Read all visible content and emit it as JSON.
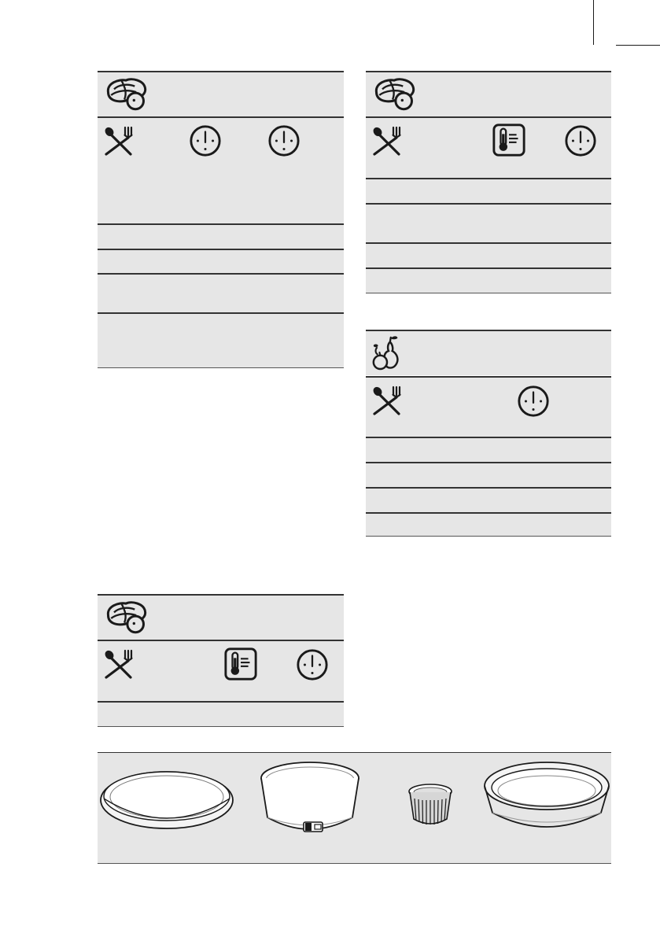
{
  "page": {
    "background": "#ffffff",
    "band_color": "#e6e6e6",
    "rule_color": "#333333"
  },
  "tables": [
    {
      "id": "table-steam-meat-left",
      "category_icon": "meat-steam-icon",
      "header_icons": [
        "food-icon",
        "clock-icon",
        "clock-icon"
      ],
      "rows": 4
    },
    {
      "id": "table-steam-meat-right",
      "category_icon": "meat-steam-icon",
      "header_icons": [
        "food-icon",
        "core-temperature-icon",
        "clock-icon"
      ],
      "rows": 4
    },
    {
      "id": "table-fruit",
      "category_icon": "fruit-icon",
      "header_icons": [
        "food-icon",
        "clock-icon"
      ],
      "rows": 4
    },
    {
      "id": "table-steam-meat-bottom",
      "category_icon": "meat-steam-icon",
      "header_icons": [
        "food-icon",
        "core-temperature-icon",
        "clock-icon"
      ],
      "rows": 1
    }
  ],
  "cookware": [
    "flat-baking-tin-icon",
    "springform-tin-icon",
    "ramekin-icon",
    "deep-baking-tin-icon"
  ]
}
